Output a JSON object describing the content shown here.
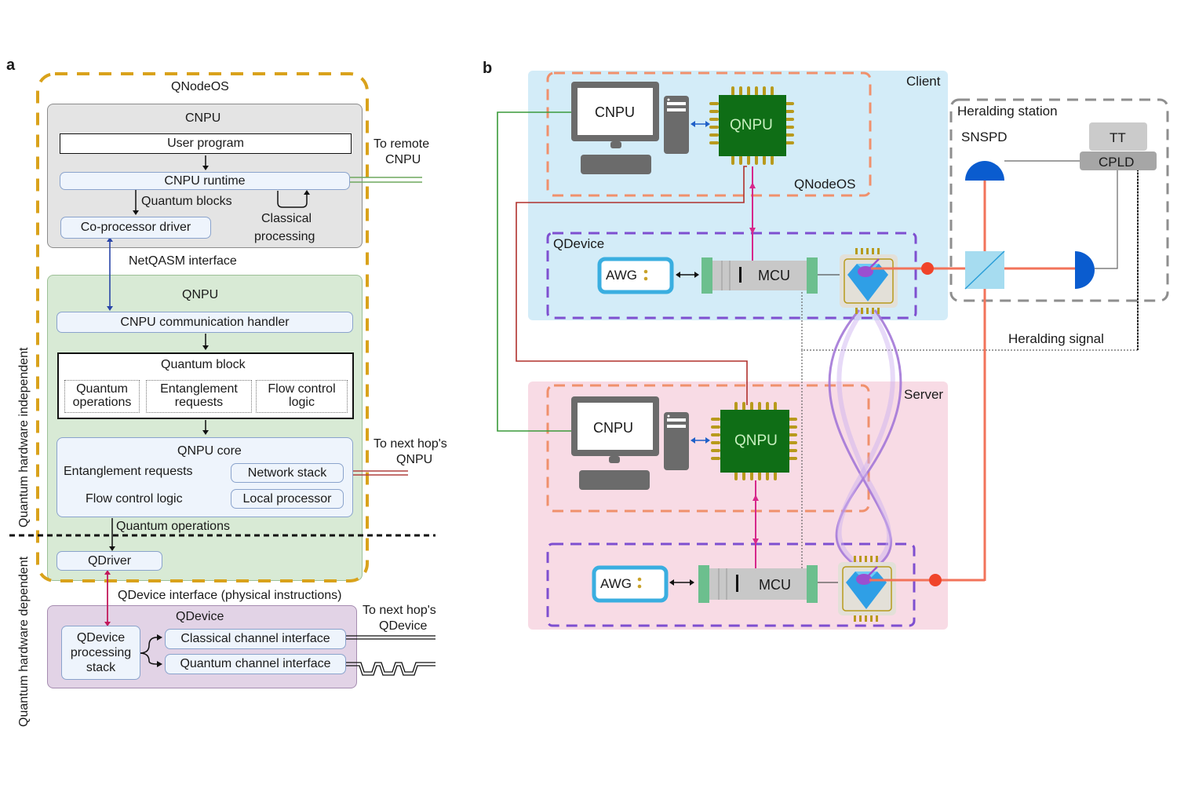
{
  "panel_a": {
    "label": "a",
    "qnodeos_title": "QNodeOS",
    "cnpu": {
      "title": "CNPU",
      "user_program": "User program",
      "runtime": "CNPU runtime",
      "quantum_blocks": "Quantum blocks",
      "classical_processing_1": "Classical",
      "classical_processing_2": "processing",
      "coprocessor_driver": "Co-processor driver"
    },
    "to_remote_cnpu_1": "To remote",
    "to_remote_cnpu_2": "CNPU",
    "netqasm_interface": "NetQASM interface",
    "qnpu": {
      "title": "QNPU",
      "comm_handler": "CNPU communication handler",
      "quantum_block": {
        "title": "Quantum block",
        "items": [
          {
            "line1": "Quantum",
            "line2": "operations"
          },
          {
            "line1": "Entanglement",
            "line2": "requests"
          },
          {
            "line1": "Flow control",
            "line2": "logic"
          }
        ]
      },
      "core": {
        "title": "QNPU core",
        "entanglement_requests": "Entanglement requests",
        "flow_control_logic": "Flow control logic",
        "network_stack": "Network stack",
        "local_processor": "Local processor"
      },
      "quantum_operations": "Quantum operations",
      "qdriver": "QDriver"
    },
    "to_next_hop_qnpu_1": "To next hop's",
    "to_next_hop_qnpu_2": "QNPU",
    "qdevice_interface": "QDevice interface (physical instructions)",
    "qdevice": {
      "title": "QDevice",
      "processing_stack_1": "QDevice",
      "processing_stack_2": "processing",
      "processing_stack_3": "stack",
      "classical_channel": "Classical channel interface",
      "quantum_channel": "Quantum channel interface"
    },
    "to_next_hop_qdevice_1": "To next hop's",
    "to_next_hop_qdevice_2": "QDevice",
    "hw_independent": "Quantum hardware independent",
    "hw_dependent": "Quantum hardware dependent"
  },
  "panel_b": {
    "label": "b",
    "client": {
      "title": "Client",
      "cnpu": "CNPU",
      "qnpu": "QNPU",
      "qnodeos": "QNodeOS",
      "qdevice": "QDevice",
      "awg": "AWG",
      "mcu": "MCU"
    },
    "server": {
      "title": "Server",
      "cnpu": "CNPU",
      "qnpu": "QNPU",
      "awg": "AWG",
      "mcu": "MCU"
    },
    "heralding_station": {
      "title": "Heralding station",
      "snspd": "SNSPD",
      "tt": "TT",
      "cpld": "CPLD"
    },
    "heralding_signal": "Heralding signal"
  },
  "colors": {
    "qnodeos_gold": "#d9a21b",
    "cnpu_gray": "#e4e4e4",
    "qnpu_green": "#d8ead5",
    "qdevice_purple": "#e2d3e6",
    "client_blue": "#d3ecf8",
    "server_pink": "#f8dbe5",
    "chip_green": "#0f6e16",
    "laser_red": "#f2735a",
    "magenta": "#d6288b"
  }
}
